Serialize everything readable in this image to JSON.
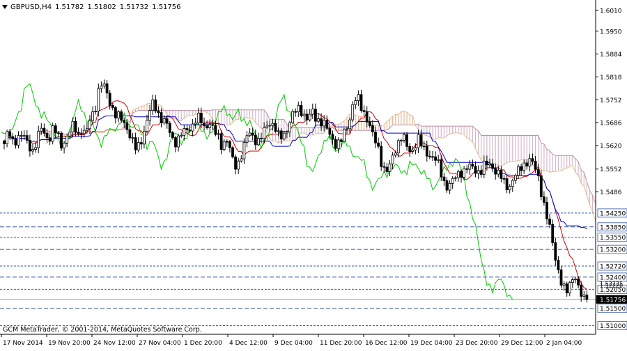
{
  "window": {
    "symbol_timeframe": "GBPUSD,H4",
    "quote_open": "1.51782",
    "quote_high": "1.51802",
    "quote_low": "1.51732",
    "quote_close": "1.51756",
    "copyright": "GCM MetaTrader, © 2001-2014, MetaQuotes Software Corp."
  },
  "colors": {
    "background": "#ffffff",
    "candle": "#000000",
    "tenkan": "#cc0000",
    "kijun": "#0000cc",
    "chikou": "#00cc00",
    "cloud_up": "#d8b8c8",
    "cloud_down": "#e8b890",
    "level_line": "#3355aa",
    "bid_line": "#999999"
  },
  "chart_data": {
    "type": "candlestick",
    "symbol": "GBPUSD",
    "timeframe": "H4",
    "ylim": [
      1.5075,
      1.604
    ],
    "price_axis_ticks": [
      "1.6010",
      "1.5950",
      "1.5884",
      "1.5818",
      "1.5752",
      "1.5686",
      "1.5620",
      "1.5552",
      "1.5486"
    ],
    "time_axis_labels": [
      "17 Nov 2014",
      "19 Nov 20:00",
      "24 Nov 12:00",
      "27 Nov 04:00",
      "1 Dec 20:00",
      "4 Dec 12:00",
      "9 Dec 04:00",
      "11 Dec 20:00",
      "16 Dec 12:00",
      "19 Dec 04:00",
      "23 Dec 20:00",
      "29 Dec 12:00",
      "2 Jan 04:00"
    ],
    "levels": [
      {
        "label": "1.54250",
        "value": 1.5425,
        "boxed": false
      },
      {
        "label": "1.53850",
        "value": 1.5385,
        "boxed": true
      },
      {
        "label": "1.53550",
        "value": 1.5355,
        "boxed": false
      },
      {
        "label": "1.53200",
        "value": 1.532,
        "boxed": false
      },
      {
        "label": "1.52720",
        "value": 1.5272,
        "boxed": true
      },
      {
        "label": "1.52400",
        "value": 1.524,
        "boxed": false
      },
      {
        "label": "1.52050",
        "value": 1.5205,
        "boxed": false
      },
      {
        "label": "1.51500",
        "value": 1.515,
        "boxed": false
      },
      {
        "label": "1.51000",
        "value": 1.51,
        "boxed": false
      }
    ],
    "minor_labels": [
      "1.52225",
      "1.52220"
    ],
    "current_price": {
      "label": "1.51756",
      "value": 1.51756
    },
    "price_path": [
      [
        1.5625,
        1.566,
        1.563,
        1.564,
        1.565,
        1.564,
        1.562,
        1.5605,
        1.5635,
        1.567,
        1.565,
        1.564,
        1.567,
        1.565,
        1.562,
        1.564,
        1.566,
        1.568,
        1.565,
        1.567,
        1.565,
        1.57,
        1.572,
        1.578,
        1.58,
        1.577,
        1.574,
        1.571,
        1.57,
        1.569
      ],
      [
        1.567,
        1.564,
        1.561,
        1.562,
        1.566,
        1.57,
        1.574,
        1.573,
        1.57,
        1.569,
        1.567,
        1.564,
        1.563,
        1.565,
        1.566,
        1.567,
        1.568,
        1.57,
        1.569,
        1.567,
        1.569,
        1.566,
        1.565,
        1.562,
        1.564,
        1.561,
        1.556,
        1.557,
        1.56,
        1.564,
        1.566,
        1.564,
        1.563,
        1.565,
        1.568,
        1.569,
        1.567,
        1.564
      ],
      [
        1.565,
        1.567,
        1.57,
        1.572,
        1.573,
        1.571,
        1.569,
        1.572,
        1.57,
        1.569,
        1.568,
        1.566,
        1.564,
        1.562,
        1.563,
        1.566,
        1.569,
        1.574,
        1.576,
        1.573,
        1.571,
        1.568,
        1.564,
        1.562,
        1.557,
        1.554,
        1.556,
        1.56,
        1.563,
        1.565,
        1.562,
        1.56,
        1.562,
        1.564,
        1.561,
        1.56,
        1.559,
        1.558,
        1.556,
        1.552,
        1.55,
        1.551,
        1.553,
        1.5545
      ],
      [
        1.5545,
        1.5555,
        1.556,
        1.555,
        1.554,
        1.556,
        1.557,
        1.556,
        1.554,
        1.553,
        1.551,
        1.55,
        1.552,
        1.554,
        1.556,
        1.557,
        1.5575,
        1.5565,
        1.554,
        1.548,
        1.542,
        1.538,
        1.532,
        1.526,
        1.521,
        1.5195,
        1.523,
        1.525,
        1.52,
        1.518,
        1.51756
      ]
    ]
  }
}
